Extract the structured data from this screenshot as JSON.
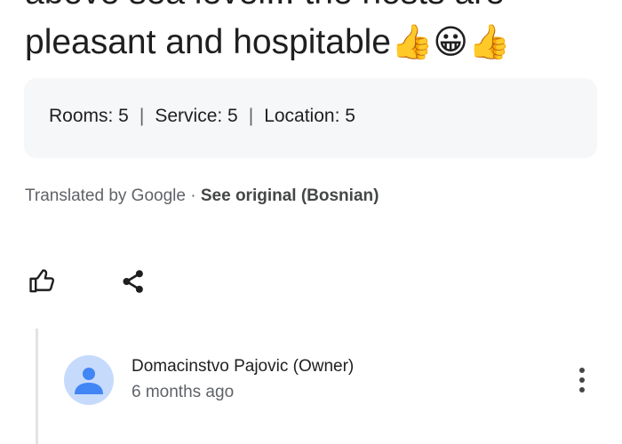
{
  "review": {
    "text_line1": "above sea level... the hosts are",
    "text_line2": "pleasant and hospitable",
    "emojis": [
      "thumbs-up",
      "grinning-face",
      "thumbs-up"
    ]
  },
  "ratings": {
    "rooms_label": "Rooms: 5",
    "service_label": "Service: 5",
    "location_label": "Location: 5",
    "separator": "|"
  },
  "translation": {
    "translated_by": "Translated by Google",
    "dot": " · ",
    "see_original": "See original (Bosnian)"
  },
  "actions": {
    "like_icon": "thumbs-up-outline-icon",
    "share_icon": "share-icon"
  },
  "owner_reply": {
    "name": "Domacinstvo Pajovic (Owner)",
    "time": "6 months ago",
    "avatar_icon": "person-icon",
    "more_icon": "more-vert-icon"
  },
  "colors": {
    "text": "#1f1f1f",
    "secondary": "#5f6368",
    "ratings_bg": "#f6f7f9",
    "avatar_bg": "#c6dafc",
    "avatar_fg": "#4285f4"
  }
}
